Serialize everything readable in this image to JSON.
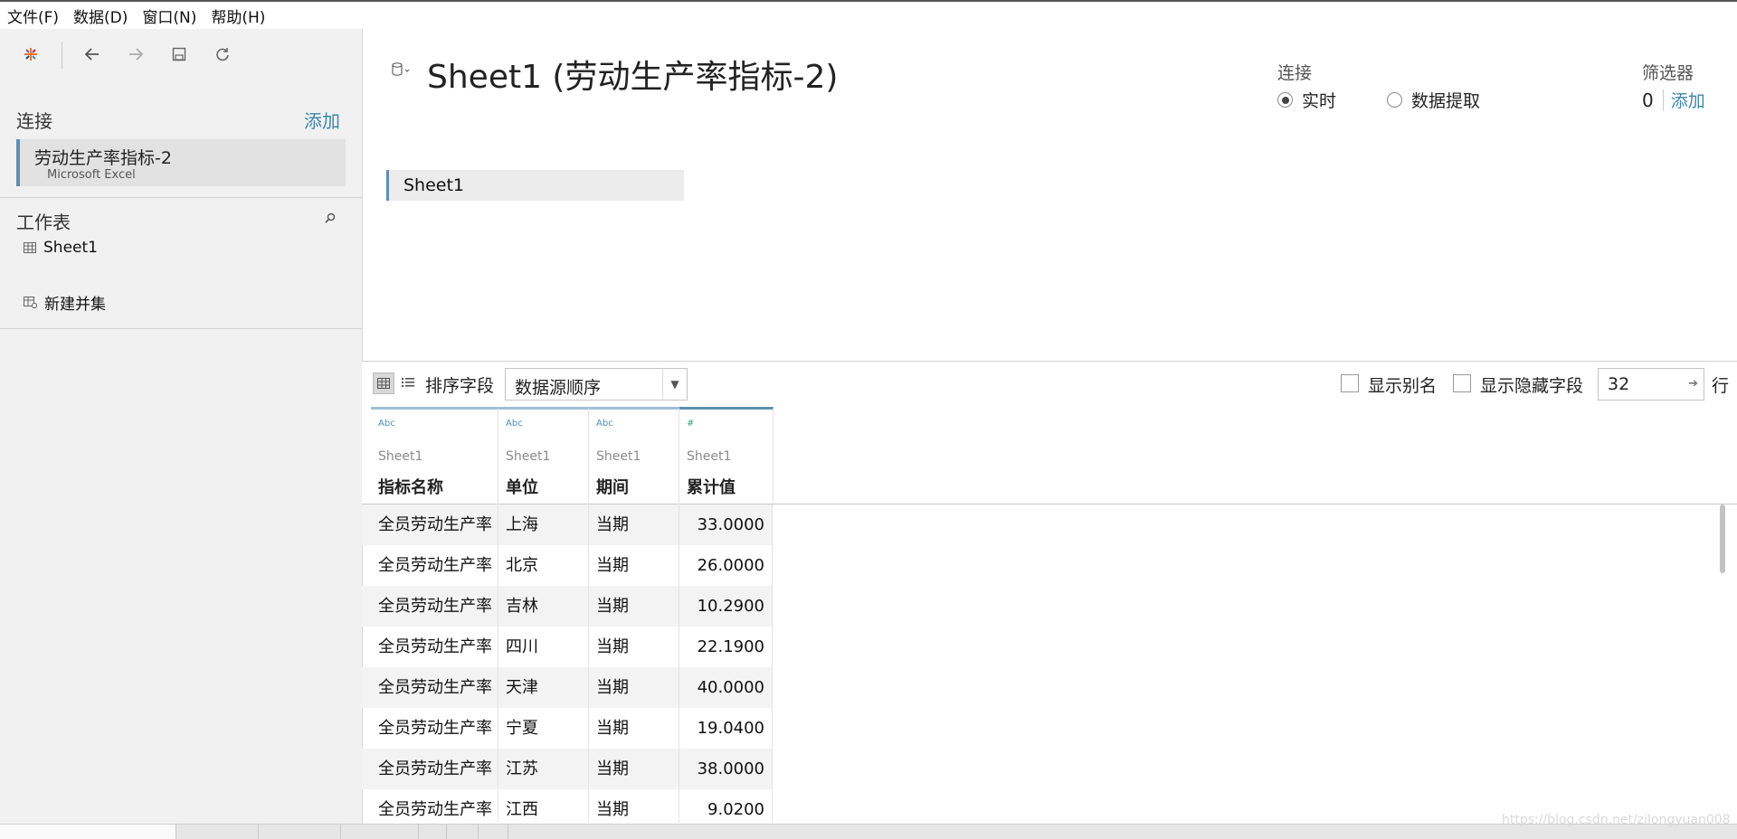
{
  "menu": {
    "items": [
      "文件(F)",
      "数据(D)",
      "窗口(N)",
      "帮助(H)"
    ]
  },
  "toolbar": {
    "icons": [
      "tableau-logo-icon",
      "back-icon",
      "forward-icon",
      "save-icon",
      "refresh-icon"
    ]
  },
  "left_panel": {
    "connection_title": "连接",
    "add_label": "添加",
    "connection": {
      "name": "劳动生产率指标-2",
      "type": "Microsoft Excel"
    },
    "worksheets_title": "工作表",
    "sheets": [
      "Sheet1"
    ],
    "new_union": "新建并集"
  },
  "datasource": {
    "title": "Sheet1 (劳动生产率指标-2)",
    "canvas_sheet": "Sheet1"
  },
  "connection_options": {
    "label": "连接",
    "live": "实时",
    "extract": "数据提取",
    "selected": "live"
  },
  "filters": {
    "label": "筛选器",
    "count": "0",
    "add": "添加"
  },
  "grid_toolbar": {
    "sort_label": "排序字段",
    "sort_value": "数据源顺序",
    "show_alias": "显示别名",
    "show_hidden": "显示隐藏字段",
    "rows_value": "32",
    "rows_suffix": "行"
  },
  "table": {
    "columns": [
      {
        "type": "Abc",
        "source": "Sheet1",
        "name": "指标名称"
      },
      {
        "type": "Abc",
        "source": "Sheet1",
        "name": "单位"
      },
      {
        "type": "Abc",
        "source": "Sheet1",
        "name": "期间"
      },
      {
        "type": "#",
        "source": "Sheet1",
        "name": "累计值"
      }
    ],
    "rows": [
      [
        "全员劳动生产率",
        "上海",
        "当期",
        "33.0000"
      ],
      [
        "全员劳动生产率",
        "北京",
        "当期",
        "26.0000"
      ],
      [
        "全员劳动生产率",
        "吉林",
        "当期",
        "10.2900"
      ],
      [
        "全员劳动生产率",
        "四川",
        "当期",
        "22.1900"
      ],
      [
        "全员劳动生产率",
        "天津",
        "当期",
        "40.0000"
      ],
      [
        "全员劳动生产率",
        "宁夏",
        "当期",
        "19.0400"
      ],
      [
        "全员劳动生产率",
        "江苏",
        "当期",
        "38.0000"
      ],
      [
        "全员劳动生产率",
        "江西",
        "当期",
        "9.0200"
      ]
    ]
  },
  "watermark": "https://blog.csdn.net/zilongyuan008",
  "colors": {
    "accent_link": "#3e86a8",
    "selection_bar": "#5b8fb3",
    "panel_bg": "#f1f1f1"
  }
}
